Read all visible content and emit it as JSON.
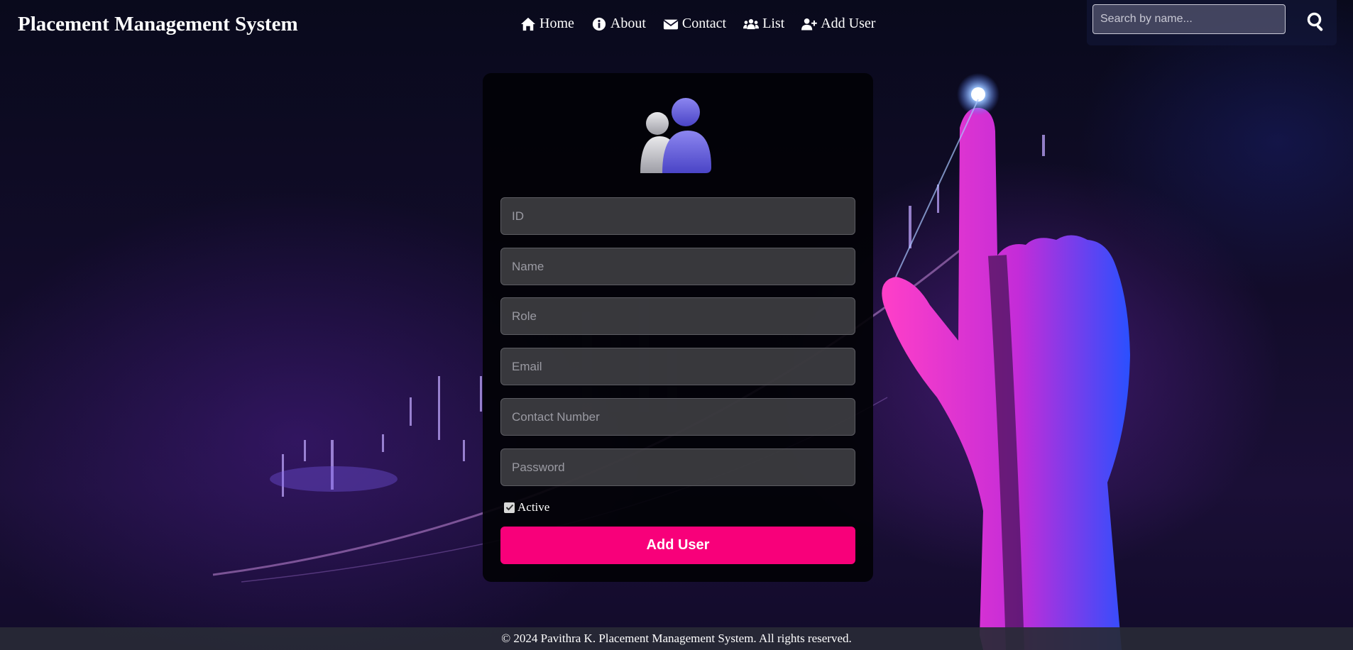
{
  "navbar": {
    "brand": "Placement Management System",
    "links": [
      {
        "label": "Home",
        "icon": "home-icon"
      },
      {
        "label": "About",
        "icon": "info-icon"
      },
      {
        "label": "Contact",
        "icon": "envelope-icon"
      },
      {
        "label": "List",
        "icon": "users-icon"
      },
      {
        "label": "Add User",
        "icon": "user-plus-icon"
      }
    ],
    "search": {
      "placeholder": "Search by name...",
      "value": "",
      "icon": "search-icon"
    }
  },
  "form": {
    "avatar_icon": "users-avatar-icon",
    "fields": {
      "id": {
        "placeholder": "ID",
        "value": ""
      },
      "name": {
        "placeholder": "Name",
        "value": ""
      },
      "role": {
        "placeholder": "Role",
        "value": ""
      },
      "email": {
        "placeholder": "Email",
        "value": ""
      },
      "contact": {
        "placeholder": "Contact Number",
        "value": ""
      },
      "password": {
        "placeholder": "Password",
        "value": ""
      }
    },
    "active": {
      "label": "Active",
      "checked": true
    },
    "submit_label": "Add User"
  },
  "footer": {
    "text": "© 2024 Pavithra K. Placement Management System. All rights reserved."
  },
  "colors": {
    "accent": "#f8007a",
    "card": "#020206",
    "background": "#0b0a1c"
  }
}
